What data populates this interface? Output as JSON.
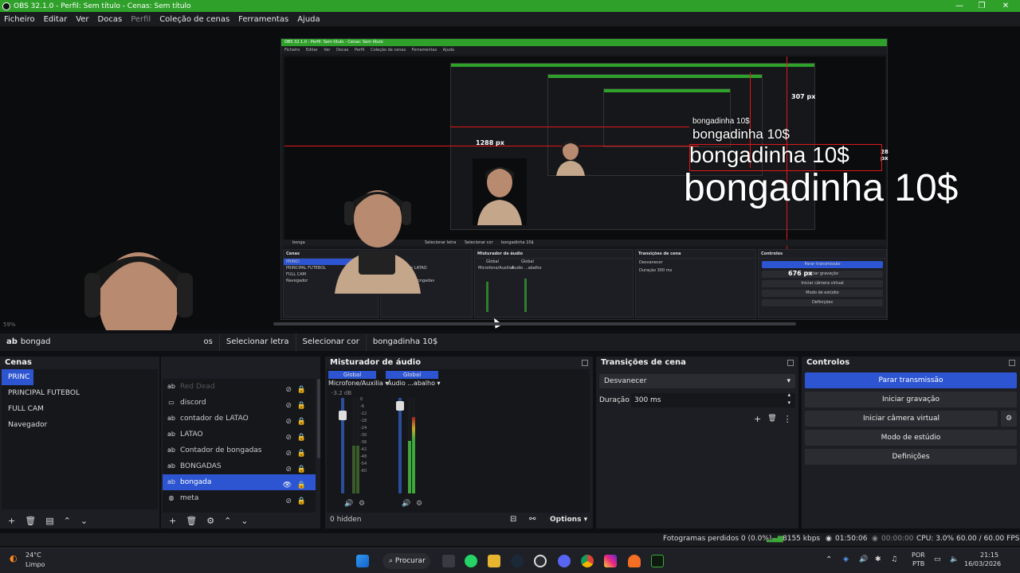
{
  "window": {
    "title": "OBS 32.1.0 - Perfil: Sem título - Cenas: Sem título",
    "controls": [
      "—",
      "❐",
      "✕"
    ]
  },
  "menu": {
    "items": [
      "Ficheiro",
      "Editar",
      "Ver",
      "Docas",
      "Perfil",
      "Coleção de cenas",
      "Ferramentas",
      "Ajuda"
    ]
  },
  "preview": {
    "nested_title": "OBS 32.1.0 - Perfil: Sem título - Cenas: Sem título",
    "nested_menu": [
      "Ficheiro",
      "Editar",
      "Ver",
      "Docas",
      "Perfil",
      "Coleção de cenas",
      "Ferramentas",
      "Ajuda"
    ],
    "text_overlays": [
      "bongadinha 10$",
      "bongadinha 10$",
      "bongadinha 10$",
      "bongadinha 10$"
    ],
    "measures": [
      "307 px",
      "1288 px",
      "28 px",
      "676 px"
    ],
    "zoom": "59%",
    "nested_source_bar": [
      "bonga",
      "Selecionar letra",
      "Selecionar cor",
      "bongadinha 10$"
    ],
    "nested_panels": {
      "cenas": "Cenas",
      "cenas_items": [
        "PRINCI",
        "PRINCIPAL FUTEBOL",
        "FULL CAM",
        "Navegador"
      ],
      "fontes_items": [
        "discord",
        "contador de LATAO",
        "LATAO",
        "Contador de bongadas"
      ],
      "mixer": "Misturador de áudio",
      "mixer_tracks": [
        "Global",
        "Global"
      ],
      "mixer_names": [
        "Microfone/Auxiliar",
        "Áudio ...abalho"
      ],
      "transitions": "Transições de cena",
      "transition_value": "Desvanecer",
      "duration_label": "Duração",
      "duration_value": "300 ms",
      "controls": "Controlos",
      "control_buttons": [
        "Parar transmissão",
        "Iniciar gravação",
        "Iniciar câmera virtual",
        "Modo de estúdio",
        "Definições"
      ]
    }
  },
  "source_toolbar": {
    "source_icon": "ab",
    "source_name": "bongad",
    "hidden_btn": "os",
    "select_font": "Selecionar letra",
    "select_color": "Selecionar cor",
    "text_value": "bongadinha 10$"
  },
  "scenes": {
    "header": "Cenas",
    "items": [
      "PRINC",
      "PRINCIPAL FUTEBOL",
      "FULL CAM",
      "Navegador"
    ]
  },
  "sources": {
    "items": [
      {
        "icon": "ab",
        "name": "Red Dead"
      },
      {
        "icon": "▭",
        "name": "discord"
      },
      {
        "icon": "ab",
        "name": "contador de LATAO"
      },
      {
        "icon": "ab",
        "name": "LATAO"
      },
      {
        "icon": "ab",
        "name": "Contador de bongadas"
      },
      {
        "icon": "ab",
        "name": "BONGADAS"
      },
      {
        "icon": "ab",
        "name": "bongada"
      },
      {
        "icon": "◍",
        "name": "meta"
      }
    ]
  },
  "mixer": {
    "header": "Misturador de áudio",
    "tracks": [
      {
        "label": "Global",
        "name": "Microfone/Auxilia",
        "db": "-3.2 dB"
      },
      {
        "label": "Global",
        "name": "Áudio ...abalho",
        "db": "0.0 dB"
      }
    ],
    "scale": [
      "0",
      "-6",
      "-12",
      "-18",
      "-24",
      "-30",
      "-36",
      "-42",
      "-48",
      "-54",
      "-60"
    ],
    "hidden_count": "0 hidden",
    "options_label": "Options"
  },
  "transitions": {
    "header": "Transições de cena",
    "selected": "Desvanecer",
    "duration_label": "Duração",
    "duration_value": "300 ms"
  },
  "controls": {
    "header": "Controlos",
    "buttons": [
      "Parar transmissão",
      "Iniciar gravação",
      "Iniciar câmera virtual",
      "Modo de estúdio",
      "Definições"
    ]
  },
  "status": {
    "dropped_frames": "Fotogramas perdidos 0 (0.0%)",
    "bitrate": "8155 kbps",
    "stream_time": "01:50:06",
    "record_time": "00:00:00",
    "cpu": "CPU: 3.0%",
    "fps": "60.00 / 60.00 FPS"
  },
  "taskbar": {
    "weather_temp": "24°C",
    "weather_desc": "Limpo",
    "search_label": "Procurar",
    "lang": "POR",
    "lang_sub": "PTB",
    "time": "21:15",
    "date": "16/03/2026"
  },
  "colors": {
    "title_green": "#2fa12a",
    "selection_blue": "#2d55d2",
    "panel_bg": "#1d1e23",
    "measure_red": "#e01818"
  }
}
